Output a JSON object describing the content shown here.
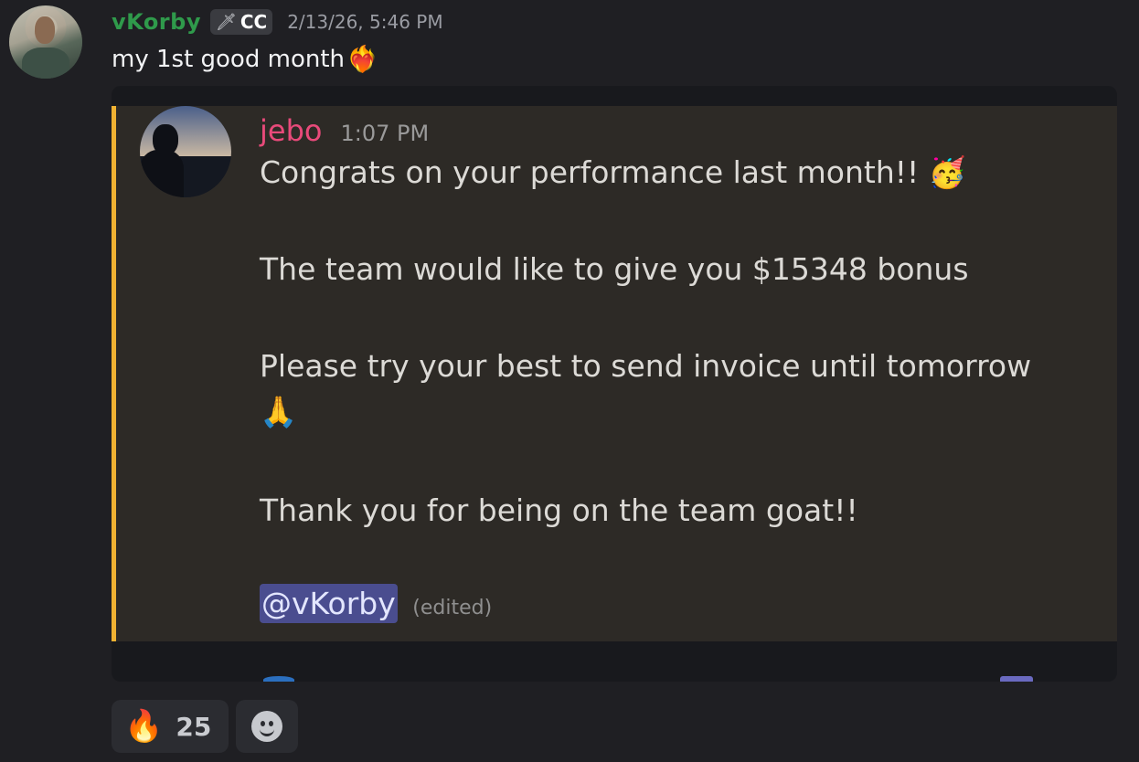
{
  "message": {
    "author": "vKorby",
    "tag_icon": "sword-icon",
    "tag_text": "CC",
    "timestamp": "2/13/26, 5:46 PM",
    "text": "my 1st good month",
    "text_emoji": "❤️‍🔥"
  },
  "embed": {
    "author": "jebo",
    "time": "1:07 PM",
    "lines": [
      "Congrats on your performance last month!! 🥳",
      "The team would like to give you $15348 bonus",
      "Please try your best to send invoice until tomorrow",
      "🙏",
      "Thank you for being on the team goat!!"
    ],
    "mention": "@vKorby",
    "edited": "(edited)",
    "accent_color": "#f0b232"
  },
  "reactions": [
    {
      "emoji": "🔥",
      "count": "25"
    }
  ],
  "add_reaction_icon": "smiley-icon",
  "colors": {
    "username": "#2f9a4b",
    "embed_username": "#e84a7a",
    "mention_bg": "#4a4d8f"
  }
}
